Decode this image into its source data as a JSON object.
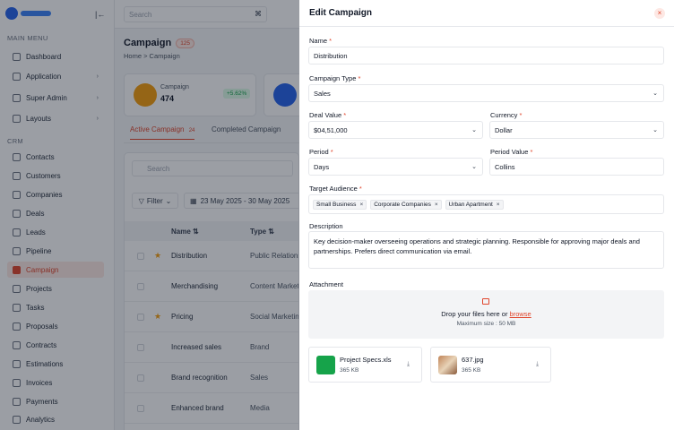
{
  "sidebar": {
    "main_menu_title": "MAIN MENU",
    "crm_title": "CRM",
    "main_items": [
      {
        "label": "Dashboard"
      },
      {
        "label": "Application"
      },
      {
        "label": "Super Admin"
      },
      {
        "label": "Layouts"
      }
    ],
    "crm_items": [
      {
        "label": "Contacts"
      },
      {
        "label": "Customers"
      },
      {
        "label": "Companies"
      },
      {
        "label": "Deals"
      },
      {
        "label": "Leads"
      },
      {
        "label": "Pipeline"
      },
      {
        "label": "Campaign"
      },
      {
        "label": "Projects"
      },
      {
        "label": "Tasks"
      },
      {
        "label": "Proposals"
      },
      {
        "label": "Contracts"
      },
      {
        "label": "Estimations"
      },
      {
        "label": "Invoices"
      },
      {
        "label": "Payments"
      },
      {
        "label": "Analytics"
      }
    ]
  },
  "topbar": {
    "search_placeholder": "Search",
    "shortcut": "⌘"
  },
  "page": {
    "title": "Campaign",
    "count": "125",
    "breadcrumb": "Home  >  Campaign",
    "stats": [
      {
        "label": "Campaign",
        "value": "474",
        "delta": "+5.62%"
      }
    ],
    "tabs": [
      {
        "label": "Active Campaign",
        "count": "24"
      },
      {
        "label": "Completed Campaign"
      }
    ],
    "list_search_placeholder": "Search",
    "filter_label": "Filter",
    "date_range": "23 May 2025 - 30 May 2025",
    "columns": {
      "name": "Name",
      "type": "Type"
    },
    "rows": [
      {
        "name": "Distribution",
        "type": "Public Relations"
      },
      {
        "name": "Merchandising",
        "type": "Content Marketing"
      },
      {
        "name": "Pricing",
        "type": "Social Marketing"
      },
      {
        "name": "Increased sales",
        "type": "Brand"
      },
      {
        "name": "Brand recognition",
        "type": "Sales"
      },
      {
        "name": "Enhanced brand",
        "type": "Media"
      }
    ]
  },
  "drawer": {
    "title": "Edit Campaign",
    "close_icon": "×",
    "name_label": "Name",
    "name_value": "Distribution",
    "type_label": "Campaign Type",
    "type_value": "Sales",
    "deal_label": "Deal Value",
    "deal_value": "$04,51,000",
    "currency_label": "Currency",
    "currency_value": "Dollar",
    "period_label": "Period",
    "period_value": "Days",
    "period_value_label": "Period Value",
    "period_value_value": "Collins",
    "audience_label": "Target Audience",
    "audience_tags": [
      "Small Business",
      "Corporate Companies",
      "Urban Apartment"
    ],
    "description_label": "Description",
    "description_value": "Key decision-maker overseeing operations and strategic planning. Responsible for approving major deals and partnerships. Prefers direct communication via email.",
    "attachment_label": "Attachment",
    "drop_text": "Drop your files here or ",
    "browse_text": "browse",
    "max_size": "Maximum size : 50 MB",
    "files": [
      {
        "name": "Project Specs.xls",
        "size": "365 KB"
      },
      {
        "name": "637.jpg",
        "size": "365 KB"
      }
    ]
  },
  "colors": {
    "accent": "#e0452b",
    "stat_orange": "#f59e0b",
    "stat_blue": "#2563eb",
    "xls_green": "#16a34a"
  }
}
